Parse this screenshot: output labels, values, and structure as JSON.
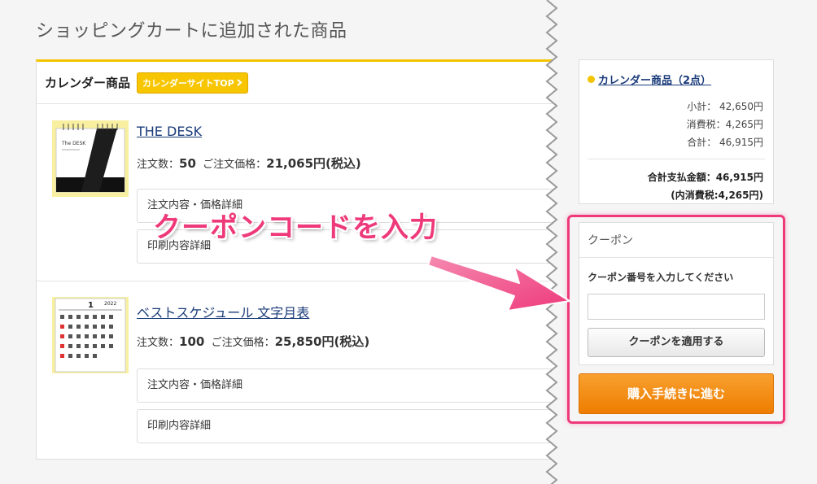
{
  "page": {
    "title": "ショッピングカートに追加された商品"
  },
  "cart": {
    "heading": "カレンダー商品",
    "top_button": "カレンダーサイトTOP",
    "top_button_icon": "chevron-right-icon",
    "items": [
      {
        "name": "THE DESK",
        "qty_label": "注文数：",
        "qty": "50",
        "price_label": "ご注文価格：",
        "price": "21,065円(税込)",
        "detail_order": "注文内容・価格詳細",
        "detail_print": "印刷内容詳細"
      },
      {
        "name": "ベストスケジュール 文字月表",
        "qty_label": "注文数：",
        "qty": "100",
        "price_label": "ご注文価格：",
        "price": "25,850円(税込)",
        "detail_order": "注文内容・価格詳細",
        "detail_print": "印刷内容詳細",
        "thumb_month": "1",
        "thumb_year": "2022"
      }
    ]
  },
  "summary": {
    "title": "カレンダー商品（2点）",
    "subtotal": "小計： 42,650円",
    "tax": "消費税：4,265円",
    "total": "合計： 46,915円",
    "grand_total": "合計支払金額：46,915円",
    "included_tax": "(内消費税:4,265円)"
  },
  "coupon": {
    "heading": "クーポン",
    "label": "クーポン番号を入力してください",
    "input_value": "",
    "input_placeholder": "",
    "apply_button": "クーポンを適用する"
  },
  "buy_button": "購入手続きに進む",
  "annotation": {
    "text": "クーポンコードを入力"
  },
  "colors": {
    "accent_yellow": "#f3c400",
    "highlight_pink": "#ee3a7a",
    "buy_orange": "#ee7d00",
    "link_navy": "#1a3b7a"
  }
}
